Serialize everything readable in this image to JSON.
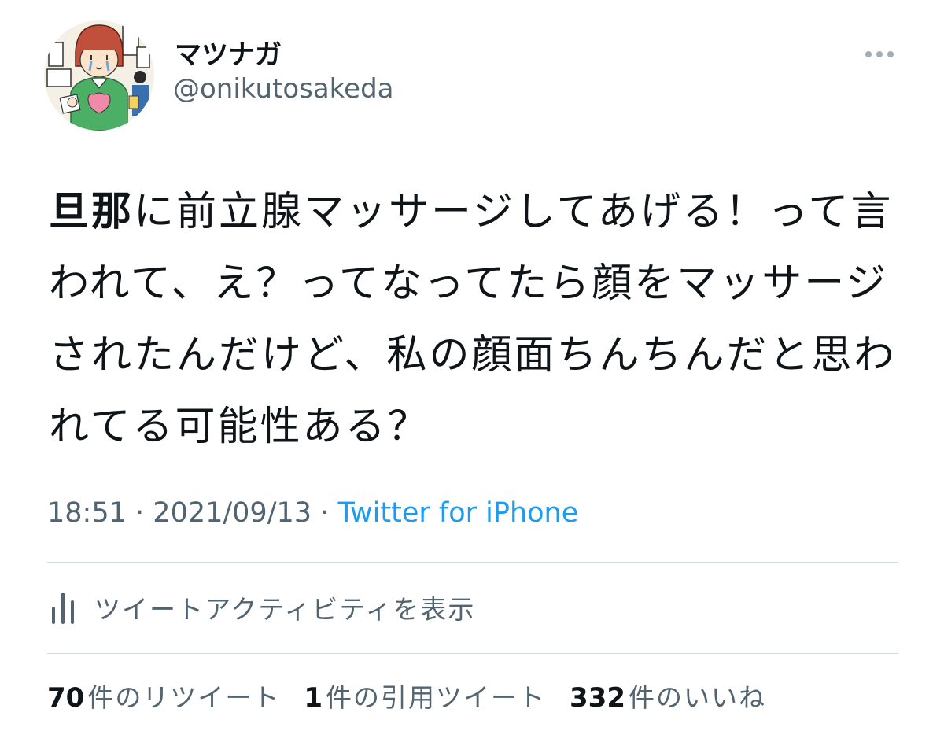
{
  "author": {
    "display_name": "マツナガ",
    "handle": "@onikutosakeda",
    "avatar_icon": "illustrated-avatar-icon"
  },
  "more_icon": "more-options-icon",
  "tweet": {
    "text_bold": "旦那",
    "text_rest": "に前立腺マッサージしてあげる！って言われて、え？ってなってたら顔をマッサージされたんだけど、私の顔面ちんちんだと思われてる可能性ある？"
  },
  "meta": {
    "time": "18:51",
    "separator": "·",
    "date": "2021/09/13",
    "source": "Twitter for iPhone"
  },
  "activity": {
    "icon": "bar-chart-icon",
    "label": "ツイートアクティビティを表示"
  },
  "stats": [
    {
      "count": "70",
      "label": "件のリツイート"
    },
    {
      "count": "1",
      "label": "件の引用ツイート"
    },
    {
      "count": "332",
      "label": "件のいいね"
    }
  ],
  "colors": {
    "text": "#0f1419",
    "secondary": "#536471",
    "link": "#1d9bf0",
    "divider": "#cfd9de"
  }
}
